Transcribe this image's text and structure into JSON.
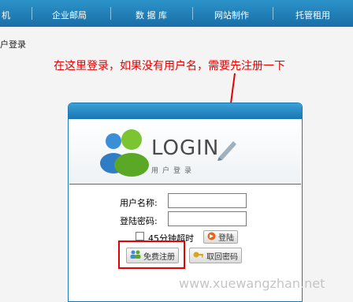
{
  "nav": {
    "items": [
      {
        "label": "机"
      },
      {
        "label": "企业邮局"
      },
      {
        "label": "数 据 库"
      },
      {
        "label": "网站制作"
      },
      {
        "label": "托管租用"
      }
    ]
  },
  "breadcrumb": "户登录",
  "hint": "在这里登录，如果没有用户名，需要先注册一下",
  "login": {
    "logo_text": "LOGIN",
    "logo_sub": "用户登录",
    "username_label": "用户名称:",
    "password_label": "登陆密码:",
    "username_value": "",
    "password_value": "",
    "timeout_label": "45分钟超时",
    "submit_label": "登陆",
    "register_label": "免费注册",
    "recover_label": "取回密码"
  },
  "watermark": "www.xuewangzhan.net",
  "colors": {
    "accent": "#1b7ab8",
    "highlight": "#e60000"
  }
}
